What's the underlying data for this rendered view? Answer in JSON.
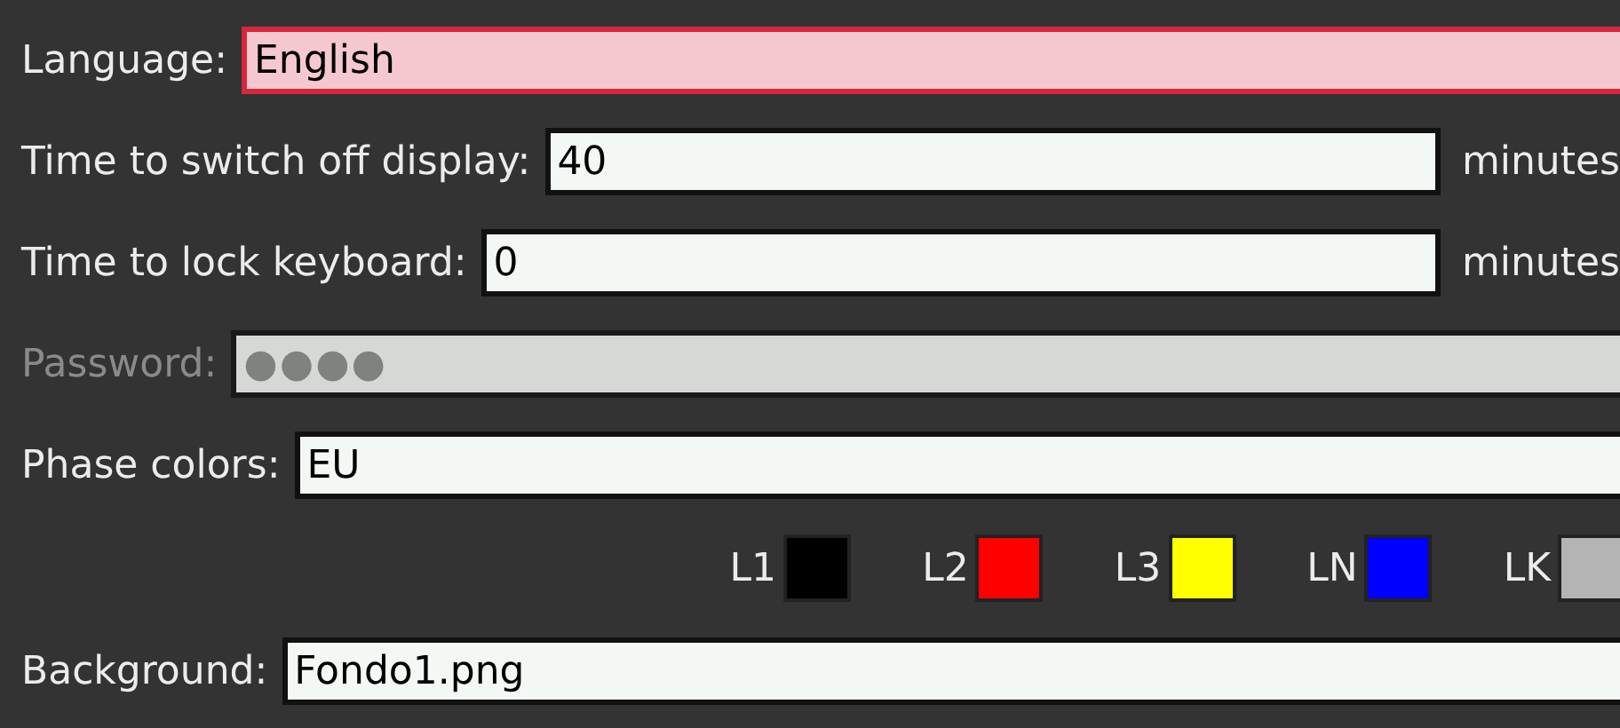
{
  "fields": [
    {
      "kind": "text",
      "label": "Language:",
      "value": "English",
      "focused": true,
      "disabled": false
    },
    {
      "kind": "text",
      "label": "Time to switch off display:",
      "value": "40",
      "unit": "minutes",
      "focused": false,
      "disabled": false
    },
    {
      "kind": "text",
      "label": "Time to lock keyboard:",
      "value": "0",
      "unit": "minutes",
      "focused": false,
      "disabled": false
    },
    {
      "kind": "password",
      "label": "Password:",
      "value": "●●●●",
      "focused": false,
      "disabled": true
    },
    {
      "kind": "text",
      "label": "Phase colors:",
      "value": "EU",
      "focused": false,
      "disabled": false
    },
    {
      "kind": "swatches",
      "swatches": [
        {
          "label": "L1",
          "color": "#000000"
        },
        {
          "label": "L2",
          "color": "#ff0000"
        },
        {
          "label": "L3",
          "color": "#ffff00"
        },
        {
          "label": "LN",
          "color": "#0000ff"
        },
        {
          "label": "LK",
          "color": "#b4b4b4"
        }
      ]
    },
    {
      "kind": "text",
      "label": "Background:",
      "value": "Fondo1.png",
      "focused": false,
      "disabled": false
    }
  ]
}
